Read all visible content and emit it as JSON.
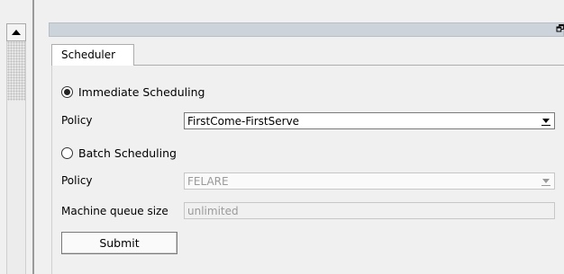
{
  "dock": {
    "float_icon": "restore-window-icon"
  },
  "tabs": [
    {
      "label": "Scheduler",
      "active": true
    }
  ],
  "immediate": {
    "radio_label": "Immediate Scheduling",
    "selected": true,
    "policy_label": "Policy",
    "policy_value": "FirstCome-FirstServe"
  },
  "batch": {
    "radio_label": "Batch Scheduling",
    "selected": false,
    "policy_label": "Policy",
    "policy_value": "FELARE",
    "queue_label": "Machine queue size",
    "queue_value": "unlimited"
  },
  "submit_label": "Submit"
}
